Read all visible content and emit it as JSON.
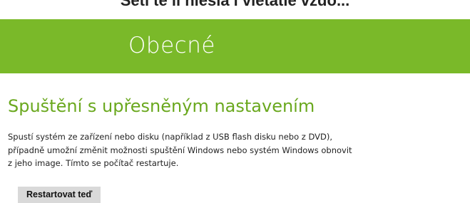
{
  "top_cutoff_text": "Setí te li niesia i vietatie vzdo...",
  "header": {
    "title": "Obecné"
  },
  "advanced_startup": {
    "heading": "Spuštění s upřesněným nastavením",
    "description_lines": [
      "Spustí systém ze zařízení nebo disku (například z USB flash disku nebo z DVD),",
      "případně umožní změnit možnosti spuštění Windows nebo systém Windows obnovit",
      "z jeho image. Tímto se počítač restartuje."
    ],
    "button_label": "Restartovat teď"
  },
  "colors": {
    "header_background": "#7ab929",
    "heading_text": "#6aa81e",
    "button_background": "#d9d9d9"
  }
}
